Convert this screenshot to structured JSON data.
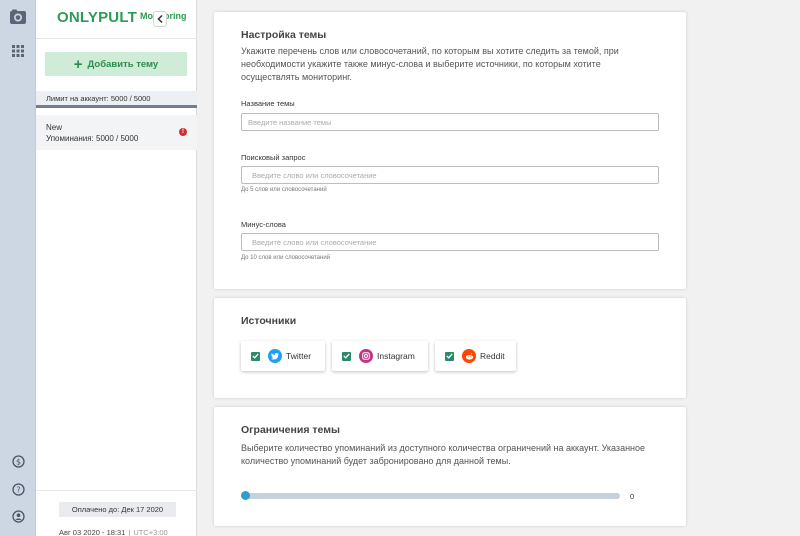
{
  "sidebar": {
    "brand": "ONLYPULT",
    "brand_sub": "Monitoring",
    "add_topic_label": "Добавить тему",
    "limit_text": "Лимит на аккаунт: 5000 / 5000",
    "topics": [
      {
        "name": "New",
        "mentions": "Упоминания: 5000 / 5000"
      }
    ],
    "paid_until": "Оплачено до: Дек 17 2020",
    "datetime": "Авг 03 2020 - 18:31",
    "timezone": "UTC+3:00"
  },
  "settings": {
    "title": "Настройка темы",
    "description": "Укажите перечень слов или словосочетаний, по которым вы хотите следить за темой, при необходимости укажите также минус-слова и выберите источники, по которым хотите осуществлять мониторинг.",
    "name_label": "Название темы",
    "name_placeholder": "Введите название темы",
    "query_label": "Поисковый запрос",
    "query_placeholder": "Введите слово или словосочетание",
    "query_hint": "До 5 слов или словосочетаний",
    "minus_label": "Минус-слова",
    "minus_placeholder": "Введите слово или словосочетание",
    "minus_hint": "До 10 слов или словосочетаний"
  },
  "sources": {
    "title": "Источники",
    "items": [
      {
        "label": "Twitter",
        "checked": true,
        "icon": "twitter-icon",
        "color": "#1da1f2"
      },
      {
        "label": "Instagram",
        "checked": true,
        "icon": "instagram-icon",
        "color": "#c13584"
      },
      {
        "label": "Reddit",
        "checked": true,
        "icon": "reddit-icon",
        "color": "#ff4500"
      }
    ]
  },
  "limits": {
    "title": "Ограничения темы",
    "description": "Выберите количество упоминаний из доступного количества ограничений на аккаунт. Указанное количество упоминаний будет забронировано для данной темы.",
    "slider_value": "0"
  },
  "colors": {
    "brand_green": "#2d9a55",
    "add_button_bg": "#cfecd9",
    "rail_bg": "#cdd6e3",
    "checkbox": "#2a8a6b",
    "slider_thumb": "#2ba0c8",
    "warning": "#d32f2f"
  }
}
